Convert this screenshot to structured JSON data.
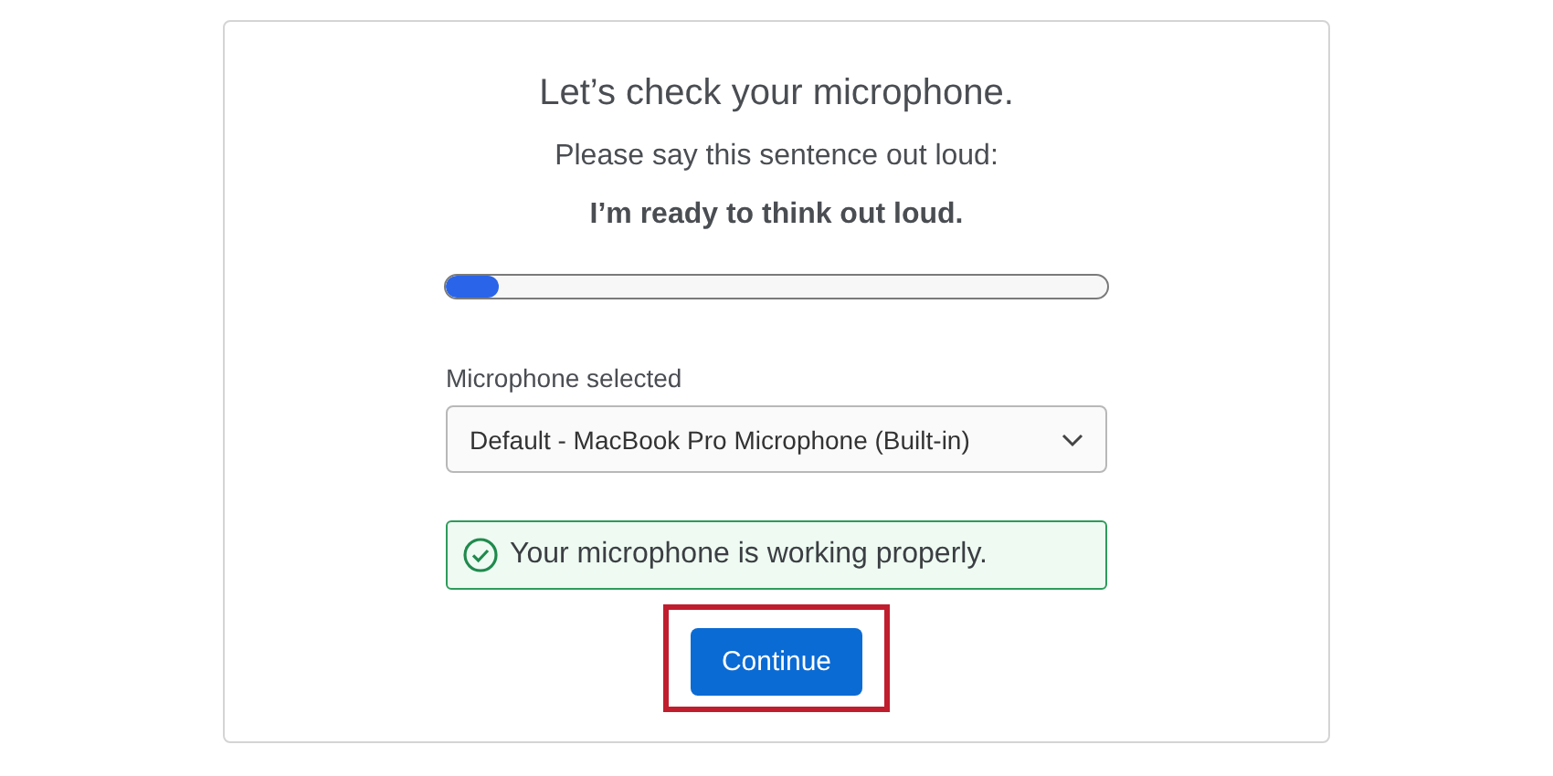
{
  "title": "Let’s check your microphone.",
  "instruction": "Please say this sentence out loud:",
  "sentence": "I’m ready to think out loud.",
  "meter": {
    "level": 0.08
  },
  "microphone": {
    "label": "Microphone selected",
    "value": "Default - MacBook Pro Microphone (Built-in)"
  },
  "status": {
    "kind": "success",
    "text": "Your microphone is working properly."
  },
  "button": {
    "label": "Continue",
    "highlighted": true
  }
}
